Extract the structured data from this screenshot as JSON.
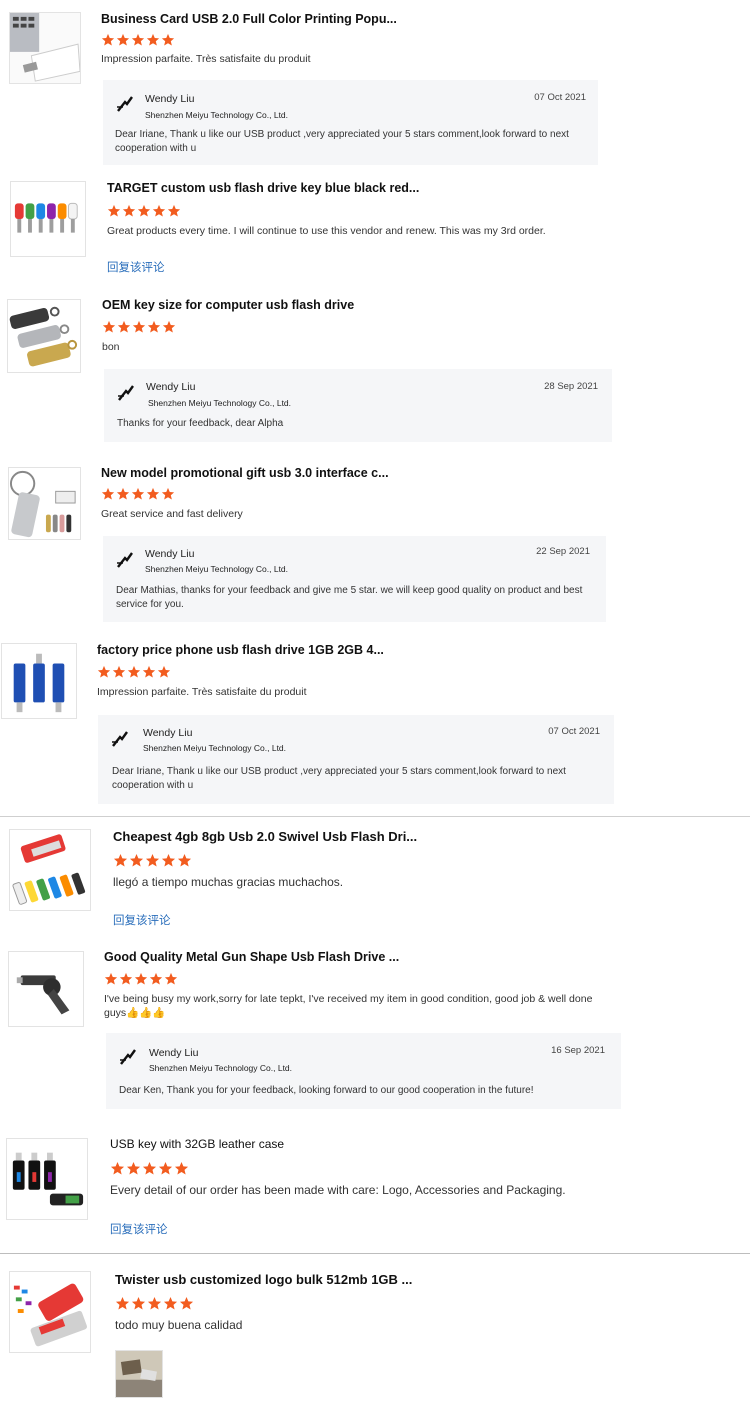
{
  "reviews": [
    {
      "title": "Business Card USB 2.0 Full Color Printing Popu...",
      "thumb_icon": "business-card-usb-image",
      "rating": 5,
      "comment": "Impression parfaite. Très satisfaite du produit",
      "reply": {
        "seller": "Wendy Liu",
        "company": "Shenzhen Meiyu Technology Co., Ltd.",
        "date": "07 Oct 2021",
        "text": "Dear Iriane, Thank u like our USB product ,very appreciated your 5 stars comment,look forward to next cooperation with u"
      }
    },
    {
      "title": "TARGET custom usb flash drive key blue black red...",
      "thumb_icon": "key-usb-colors-image",
      "rating": 5,
      "comment": "Great products every time. I will continue to use this vendor and renew. This was my 3rd order.",
      "reply_link": "回复该评论"
    },
    {
      "title": "OEM key size for computer usb flash drive",
      "thumb_icon": "metal-usb-image",
      "rating": 5,
      "comment": "bon",
      "reply": {
        "seller": "Wendy Liu",
        "company": "Shenzhen Meiyu Technology Co., Ltd.",
        "date": "28 Sep 2021",
        "text": "Thanks for your feedback, dear Alpha"
      }
    },
    {
      "title": "New model promotional gift usb 3.0 interface c...",
      "thumb_icon": "keyring-usb-image",
      "rating": 5,
      "comment": "Great service and fast delivery",
      "reply": {
        "seller": "Wendy Liu",
        "company": "Shenzhen Meiyu Technology Co., Ltd.",
        "date": "22 Sep 2021",
        "text": "Dear Mathias, thanks for your feedback and give me 5 star. we will keep good quality on product and best service for you."
      }
    },
    {
      "title": "factory price phone usb flash drive 1GB 2GB 4...",
      "thumb_icon": "blue-swivel-usb-image",
      "rating": 5,
      "comment": "Impression parfaite. Très satisfaite du produit",
      "reply": {
        "seller": "Wendy Liu",
        "company": "Shenzhen Meiyu Technology Co., Ltd.",
        "date": "07 Oct 2021",
        "text": "Dear Iriane, Thank u like our USB product ,very appreciated your 5 stars comment,look forward to next cooperation with u"
      }
    },
    {
      "title": "Cheapest 4gb 8gb Usb 2.0 Swivel Usb Flash Dri...",
      "thumb_icon": "swivel-usb-colors-image",
      "rating": 5,
      "comment": "llegó a tiempo muchas gracias muchachos.",
      "reply_link": "回复该评论"
    },
    {
      "title": "Good Quality Metal Gun Shape Usb Flash Drive ...",
      "thumb_icon": "gun-usb-image",
      "rating": 5,
      "comment": "I've being busy my work,sorry for late tepkt, I've received my item in good condition, good job & well done guys👍👍👍",
      "reply": {
        "seller": "Wendy Liu",
        "company": "Shenzhen Meiyu Technology Co., Ltd.",
        "date": "16 Sep 2021",
        "text": "Dear Ken, Thank you for your feedback, looking forward to our good cooperation in the future!"
      }
    },
    {
      "title": "USB key with 32GB leather case",
      "thumb_icon": "leather-case-usb-image",
      "rating": 5,
      "comment": "Every detail of our order has been made with care: Logo, Accessories and Packaging.",
      "reply_link": "回复该评论"
    },
    {
      "title": "Twister usb customized logo bulk 512mb 1GB ...",
      "thumb_icon": "twister-usb-image",
      "rating": 5,
      "comment": "todo muy buena calidad",
      "attachment_icon": "customer-photo-thumbnail"
    }
  ],
  "colors": {
    "star": "#f25c1f",
    "link": "#2a6ebb",
    "reply_bg": "#f5f6f8"
  }
}
